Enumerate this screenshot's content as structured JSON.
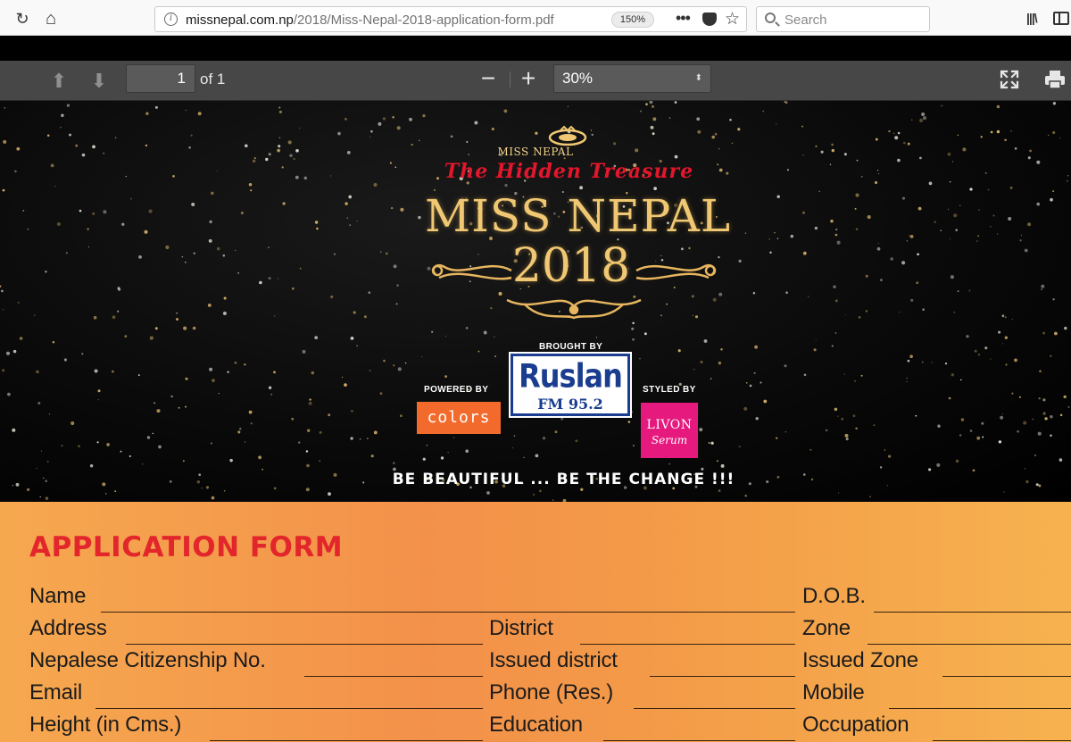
{
  "browser": {
    "url_domain": "missnepal.com.np",
    "url_path": "/2018/Miss-Nepal-2018-application-form.pdf",
    "zoom_badge": "150%",
    "more_label": "•••",
    "search_placeholder": "Search",
    "reload_glyph": "↻",
    "home_glyph": "⌂",
    "star_glyph": "☆",
    "library_glyph": "|||\\"
  },
  "pdf_toolbar": {
    "prev_glyph": "⬆",
    "next_glyph": "⬇",
    "page_number": "1",
    "page_count_label": "of 1",
    "zoom_out_label": "−",
    "zoom_in_label": "+",
    "zoom_value": "30%",
    "caret": "⬍"
  },
  "banner": {
    "small_brand": "MISS NEPAL",
    "subtitle": "The Hidden Treasure",
    "title": "MISS NEPAL",
    "year": "2018",
    "brought_by": "BROUGHT BY",
    "ruslan_name": "Ruslan",
    "ruslan_fm": "FM 95.2",
    "powered_by": "POWERED BY",
    "colors_name": "colors",
    "styled_by": "STYLED BY",
    "livon_name": "LIVON",
    "livon_sub": "Serum",
    "tagline": "BE BEAUTIFUL ... BE THE CHANGE !!!",
    "gold_color": "#f0c873",
    "red_color": "#e3162c"
  },
  "form": {
    "title": "APPLICATION FORM",
    "rows": [
      [
        {
          "label": "Name"
        },
        {
          "label": "D.O.B."
        }
      ],
      [
        {
          "label": "Address"
        },
        {
          "label": "District"
        },
        {
          "label": "Zone"
        }
      ],
      [
        {
          "label": "Nepalese Citizenship No."
        },
        {
          "label": "Issued district"
        },
        {
          "label": "Issued Zone"
        }
      ],
      [
        {
          "label": "Email"
        },
        {
          "label": "Phone (Res.)"
        },
        {
          "label": "Mobile"
        }
      ],
      [
        {
          "label": "Height (in Cms.)"
        },
        {
          "label": "Education"
        },
        {
          "label": "Occupation"
        }
      ]
    ]
  }
}
